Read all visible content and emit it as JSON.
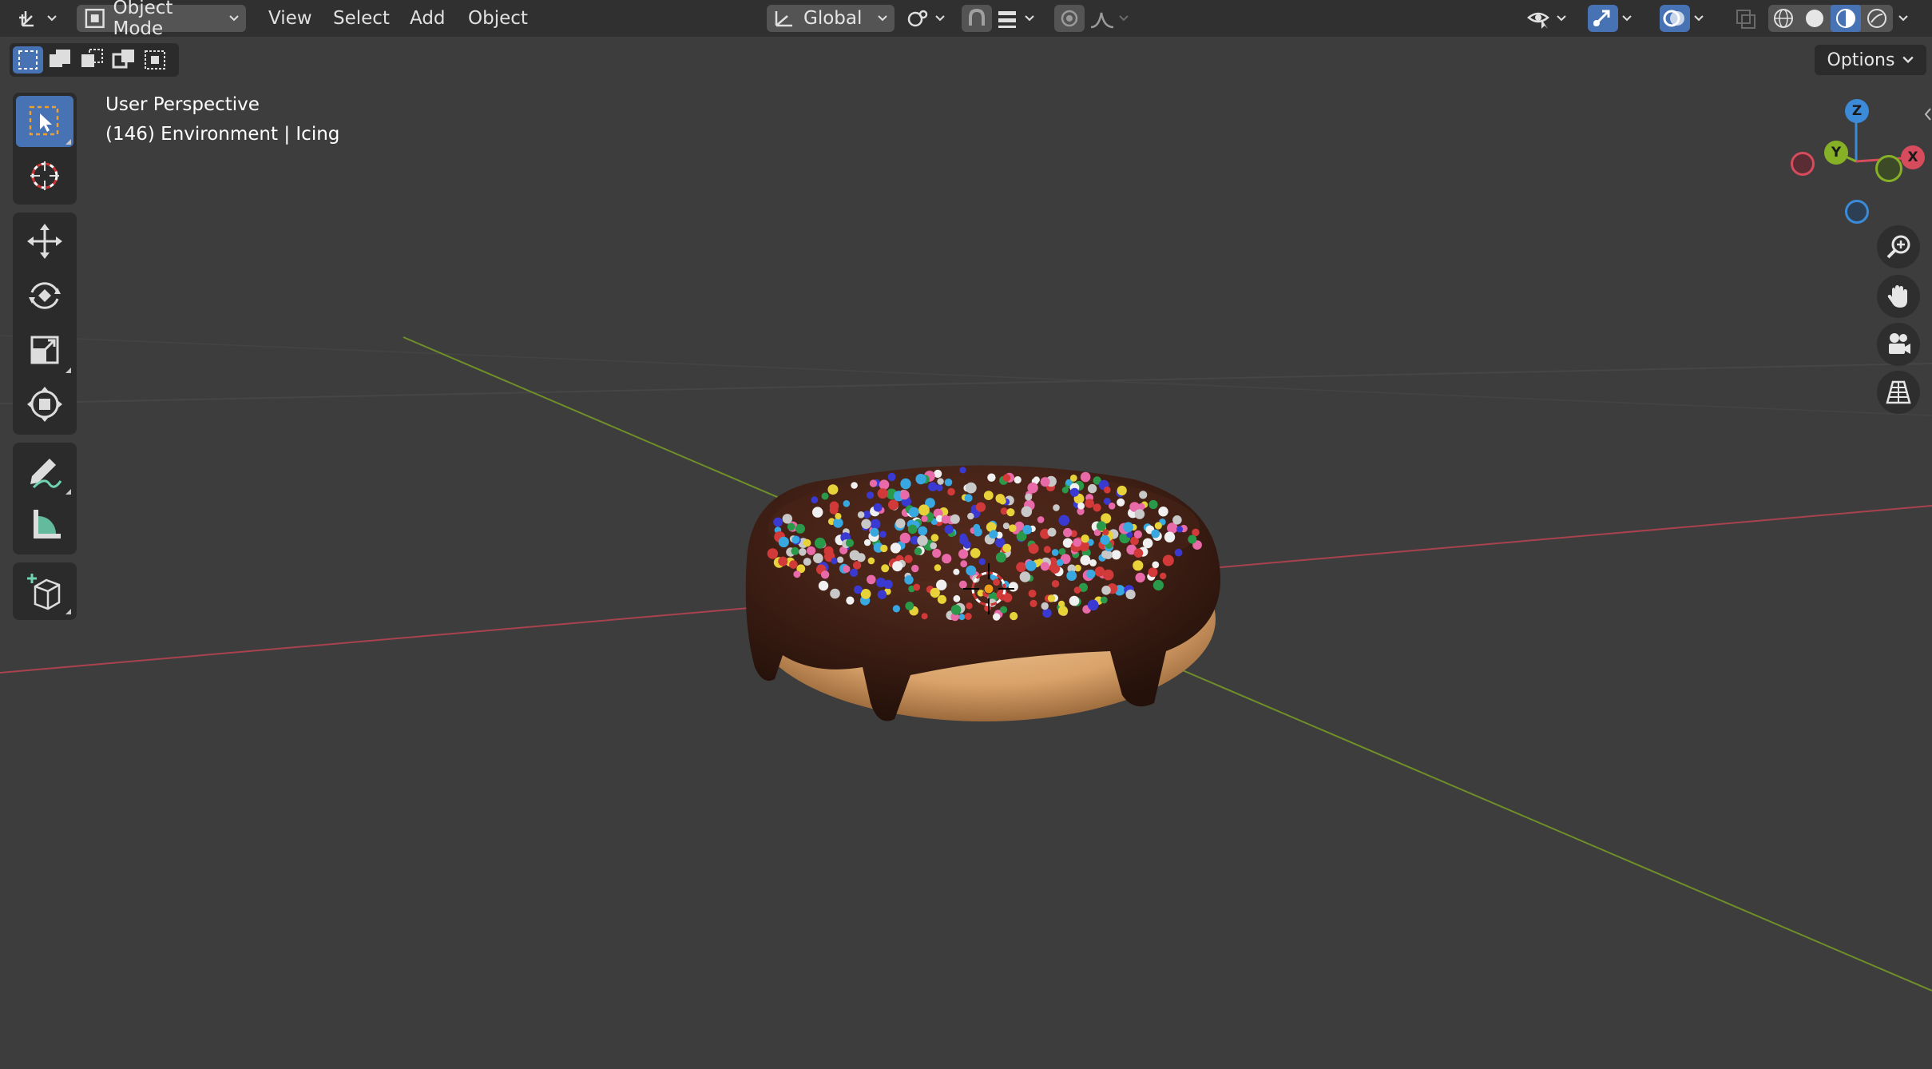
{
  "header": {
    "editor_type_icon": "axes-editor-icon",
    "mode_label": "Object Mode",
    "menus": [
      "View",
      "Select",
      "Add",
      "Object"
    ],
    "transform_orientation": "Global"
  },
  "options": {
    "label": "Options"
  },
  "viewport_info": {
    "view_name": "User Perspective",
    "object_info": "(146) Environment | Icing"
  },
  "gizmo": {
    "z": "Z",
    "y": "Y",
    "x": "X"
  },
  "colors": {
    "accent": "#4772b3",
    "header_bg": "#303030",
    "viewport_bg": "#3d3d3d",
    "axis_x": "#d64c5c",
    "axis_y": "#86b126",
    "axis_z": "#3b8bd9"
  }
}
